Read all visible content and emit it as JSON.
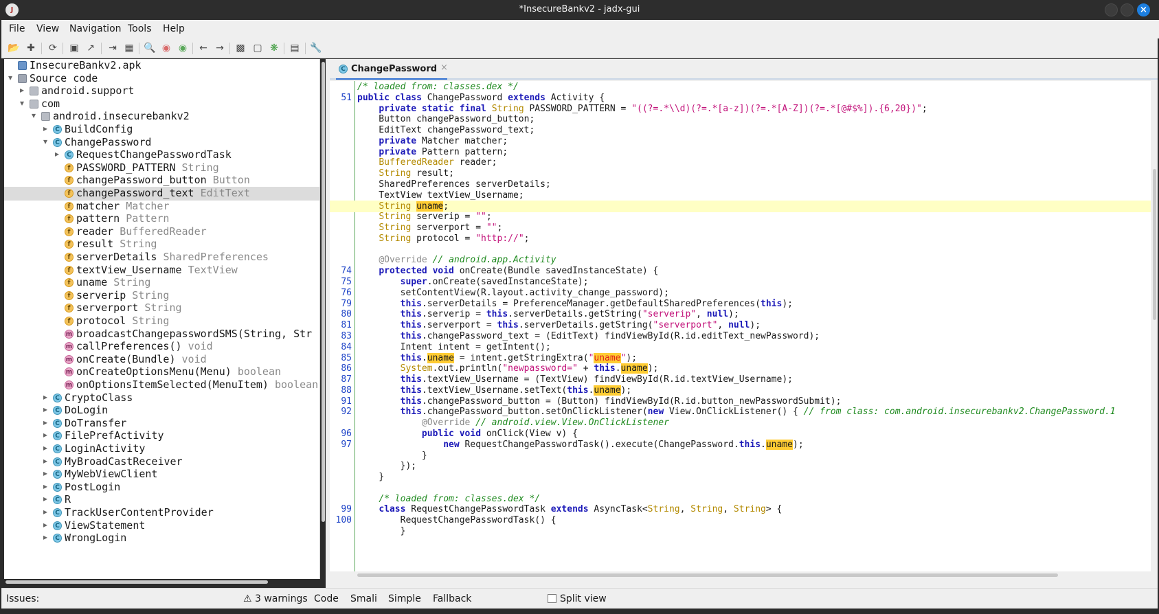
{
  "window": {
    "title": "*InsecureBankv2 - jadx-gui"
  },
  "menu": [
    "File",
    "View",
    "Navigation",
    "Tools",
    "Help"
  ],
  "toolbar_icons": [
    "open-icon",
    "add-file-icon",
    "sync-icon",
    "save-icon",
    "export-icon",
    "flatten-icon",
    "quark-icon",
    "search-icon",
    "find-usage-icon",
    "find-text-icon",
    "back-icon",
    "forward-icon",
    "decompile-icon",
    "bookmark-icon",
    "debug-icon",
    "log-icon",
    "preferences-icon"
  ],
  "tree": [
    {
      "arrow": "",
      "icon": "apk",
      "label": "InsecureBankv2.apk",
      "type": ""
    },
    {
      "arrow": "▾",
      "icon": "src",
      "label": "Source code",
      "type": ""
    },
    {
      "arrow": "▸",
      "icon": "pkg",
      "label": "android.support",
      "type": ""
    },
    {
      "arrow": "▾",
      "icon": "pkg",
      "label": "com",
      "type": ""
    },
    {
      "arrow": "▾",
      "icon": "pkg",
      "label": "android.insecurebankv2",
      "type": ""
    },
    {
      "arrow": "▸",
      "icon": "cls",
      "label": "BuildConfig",
      "type": ""
    },
    {
      "arrow": "▾",
      "icon": "cls",
      "label": "ChangePassword",
      "type": ""
    },
    {
      "arrow": "▸",
      "icon": "cls",
      "label": "RequestChangePasswordTask",
      "type": ""
    },
    {
      "arrow": "",
      "icon": "fld",
      "label": "PASSWORD_PATTERN",
      "type": "String"
    },
    {
      "arrow": "",
      "icon": "fld",
      "label": "changePassword_button",
      "type": "Button"
    },
    {
      "arrow": "",
      "icon": "fld",
      "label": "changePassword_text",
      "type": "EditText"
    },
    {
      "arrow": "",
      "icon": "fld",
      "label": "matcher",
      "type": "Matcher"
    },
    {
      "arrow": "",
      "icon": "fld",
      "label": "pattern",
      "type": "Pattern"
    },
    {
      "arrow": "",
      "icon": "fld",
      "label": "reader",
      "type": "BufferedReader"
    },
    {
      "arrow": "",
      "icon": "fld",
      "label": "result",
      "type": "String"
    },
    {
      "arrow": "",
      "icon": "fld",
      "label": "serverDetails",
      "type": "SharedPreferences"
    },
    {
      "arrow": "",
      "icon": "fld",
      "label": "textView_Username",
      "type": "TextView"
    },
    {
      "arrow": "",
      "icon": "fld",
      "label": "uname",
      "type": "String"
    },
    {
      "arrow": "",
      "icon": "fld",
      "label": "serverip",
      "type": "String"
    },
    {
      "arrow": "",
      "icon": "fld",
      "label": "serverport",
      "type": "String"
    },
    {
      "arrow": "",
      "icon": "fld",
      "label": "protocol",
      "type": "String"
    },
    {
      "arrow": "",
      "icon": "mth",
      "label": "broadcastChangepasswordSMS(String, Str",
      "type": ""
    },
    {
      "arrow": "",
      "icon": "mth",
      "label": "callPreferences()",
      "type": "void"
    },
    {
      "arrow": "",
      "icon": "mth",
      "label": "onCreate(Bundle)",
      "type": "void"
    },
    {
      "arrow": "",
      "icon": "mth",
      "label": "onCreateOptionsMenu(Menu)",
      "type": "boolean"
    },
    {
      "arrow": "",
      "icon": "mth",
      "label": "onOptionsItemSelected(MenuItem)",
      "type": "boolean"
    },
    {
      "arrow": "▸",
      "icon": "cls",
      "label": "CryptoClass",
      "type": ""
    },
    {
      "arrow": "▸",
      "icon": "cls",
      "label": "DoLogin",
      "type": ""
    },
    {
      "arrow": "▸",
      "icon": "cls",
      "label": "DoTransfer",
      "type": ""
    },
    {
      "arrow": "▸",
      "icon": "cls",
      "label": "FilePrefActivity",
      "type": ""
    },
    {
      "arrow": "▸",
      "icon": "cls",
      "label": "LoginActivity",
      "type": ""
    },
    {
      "arrow": "▸",
      "icon": "cls",
      "label": "MyBroadCastReceiver",
      "type": ""
    },
    {
      "arrow": "▸",
      "icon": "cls",
      "label": "MyWebViewClient",
      "type": ""
    },
    {
      "arrow": "▸",
      "icon": "cls",
      "label": "PostLogin",
      "type": ""
    },
    {
      "arrow": "▸",
      "icon": "cls",
      "label": "R",
      "type": ""
    },
    {
      "arrow": "▸",
      "icon": "cls",
      "label": "TrackUserContentProvider",
      "type": ""
    },
    {
      "arrow": "▸",
      "icon": "cls",
      "label": "ViewStatement",
      "type": ""
    },
    {
      "arrow": "▸",
      "icon": "cls",
      "label": "WrongLogin",
      "type": ""
    }
  ],
  "editor": {
    "tab_label": "ChangePassword",
    "tab_close": "×",
    "lines": [
      {
        "n": "",
        "html": "<span class=\"cm\">/* loaded from: classes.dex */</span>"
      },
      {
        "n": "51",
        "html": "<span class=\"kw\">public class</span> ChangePassword <span class=\"kw\">extends</span> Activity {"
      },
      {
        "n": "",
        "html": "    <span class=\"kw\">private static final</span> <span class=\"ty\">String</span> PASSWORD_PATTERN = <span class=\"st\">\"((?=.*\\\\d)(?=.*[a-z])(?=.*[A-Z])(?=.*[@#$%]).{6,20})\"</span>;"
      },
      {
        "n": "",
        "html": "    Button changePassword_button;"
      },
      {
        "n": "",
        "html": "    EditText changePassword_text;"
      },
      {
        "n": "",
        "html": "    <span class=\"kw\">private</span> Matcher matcher;"
      },
      {
        "n": "",
        "html": "    <span class=\"kw\">private</span> Pattern pattern;"
      },
      {
        "n": "",
        "html": "    <span class=\"ty\">BufferedReader</span> reader;"
      },
      {
        "n": "",
        "html": "    <span class=\"ty\">String</span> result;"
      },
      {
        "n": "",
        "html": "    SharedPreferences serverDetails;"
      },
      {
        "n": "",
        "html": "    TextView textView_Username;"
      },
      {
        "n": "",
        "hl": true,
        "html": "    <span class=\"ty\">String</span> <span class=\"mark\">uname</span>;"
      },
      {
        "n": "",
        "html": "    <span class=\"ty\">String</span> serverip = <span class=\"st\">\"\"</span>;"
      },
      {
        "n": "",
        "html": "    <span class=\"ty\">String</span> serverport = <span class=\"st\">\"\"</span>;"
      },
      {
        "n": "",
        "html": "    <span class=\"ty\">String</span> protocol = <span class=\"st\">\"http://\"</span>;"
      },
      {
        "n": "",
        "html": ""
      },
      {
        "n": "",
        "html": "    <span class=\"an\">@Override</span> <span class=\"cm\">// android.app.Activity</span>"
      },
      {
        "n": "74",
        "html": "    <span class=\"kw\">protected void</span> onCreate(Bundle savedInstanceState) {"
      },
      {
        "n": "75",
        "html": "        <span class=\"kw\">super</span>.onCreate(savedInstanceState);"
      },
      {
        "n": "76",
        "html": "        setContentView(R.layout.activity_change_password);"
      },
      {
        "n": "79",
        "html": "        <span class=\"kw\">this</span>.serverDetails = PreferenceManager.getDefaultSharedPreferences(<span class=\"kw\">this</span>);"
      },
      {
        "n": "80",
        "html": "        <span class=\"kw\">this</span>.serverip = <span class=\"kw\">this</span>.serverDetails.getString(<span class=\"st\">\"serverip\"</span>, <span class=\"kw\">null</span>);"
      },
      {
        "n": "81",
        "html": "        <span class=\"kw\">this</span>.serverport = <span class=\"kw\">this</span>.serverDetails.getString(<span class=\"st\">\"serverport\"</span>, <span class=\"kw\">null</span>);"
      },
      {
        "n": "83",
        "html": "        <span class=\"kw\">this</span>.changePassword_text = (EditText) findViewById(R.id.editText_newPassword);"
      },
      {
        "n": "84",
        "html": "        Intent intent = getIntent();"
      },
      {
        "n": "85",
        "html": "        <span class=\"kw\">this</span>.<span class=\"mark\">uname</span> = intent.getStringExtra(<span class=\"st\">\"</span><span class=\"mark-red\">uname</span><span class=\"st\">\"</span>);"
      },
      {
        "n": "86",
        "html": "        <span class=\"ty\">System</span>.out.println(<span class=\"st\">\"newpassword=\"</span> + <span class=\"kw\">this</span>.<span class=\"mark\">uname</span>);"
      },
      {
        "n": "87",
        "html": "        <span class=\"kw\">this</span>.textView_Username = (TextView) findViewById(R.id.textView_Username);"
      },
      {
        "n": "88",
        "html": "        <span class=\"kw\">this</span>.textView_Username.setText(<span class=\"kw\">this</span>.<span class=\"mark\">uname</span>);"
      },
      {
        "n": "91",
        "html": "        <span class=\"kw\">this</span>.changePassword_button = (Button) findViewById(R.id.button_newPasswordSubmit);"
      },
      {
        "n": "92",
        "html": "        <span class=\"kw\">this</span>.changePassword_button.setOnClickListener(<span class=\"kw\">new</span> View.OnClickListener() { <span class=\"cm\">// from class: com.android.insecurebankv2.ChangePassword.1</span>"
      },
      {
        "n": "",
        "html": "            <span class=\"an\">@Override</span> <span class=\"cm\">// android.view.View.OnClickListener</span>"
      },
      {
        "n": "96",
        "html": "            <span class=\"kw\">public void</span> onClick(View v) {"
      },
      {
        "n": "97",
        "html": "                <span class=\"kw\">new</span> RequestChangePasswordTask().execute(ChangePassword.<span class=\"kw\">this</span>.<span class=\"mark\">uname</span>);"
      },
      {
        "n": "",
        "html": "            }"
      },
      {
        "n": "",
        "html": "        });"
      },
      {
        "n": "",
        "html": "    }"
      },
      {
        "n": "",
        "html": ""
      },
      {
        "n": "",
        "html": "    <span class=\"cm\">/* loaded from: classes.dex */</span>"
      },
      {
        "n": "99",
        "html": "    <span class=\"kw\">class</span> RequestChangePasswordTask <span class=\"kw\">extends</span> AsyncTask&lt;<span class=\"ty\">String</span>, <span class=\"ty\">String</span>, <span class=\"ty\">String</span>&gt; {"
      },
      {
        "n": "100",
        "html": "        RequestChangePasswordTask() {"
      },
      {
        "n": "",
        "html": "        }"
      }
    ]
  },
  "status": {
    "issues_label": "Issues:",
    "warnings": "3 warnings",
    "modes": [
      "Code",
      "Smali",
      "Simple",
      "Fallback"
    ],
    "split_view": "Split view"
  },
  "colors": {
    "accent": "#2f6fd1",
    "keyword": "#1c1ab8",
    "string": "#c2127a",
    "comment": "#1f8a1f",
    "highlight": "#ffcc33"
  }
}
